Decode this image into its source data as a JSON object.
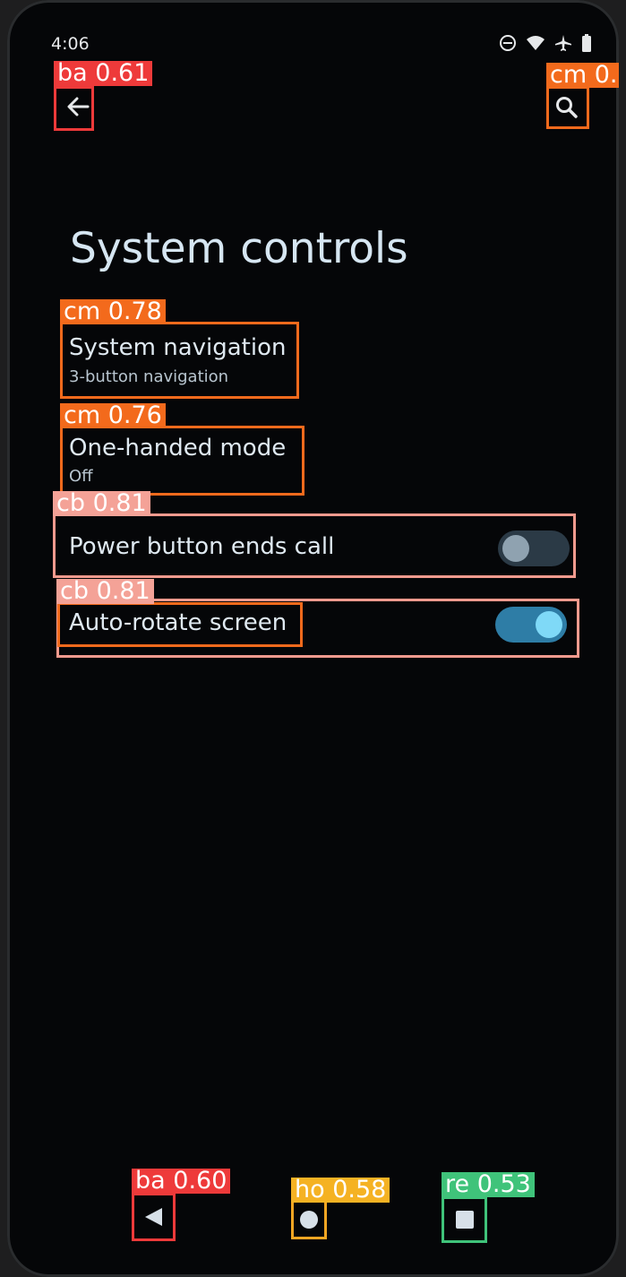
{
  "status_bar": {
    "time": "4:06",
    "icons": [
      "do-not-disturb-icon",
      "wifi-icon",
      "airplane-icon",
      "battery-icon"
    ]
  },
  "header": {
    "back_icon": "arrow-left-icon",
    "search_icon": "search-icon"
  },
  "page": {
    "title": "System controls"
  },
  "settings": [
    {
      "title": "System navigation",
      "subtitle": "3-button navigation"
    },
    {
      "title": "One-handed mode",
      "subtitle": "Off"
    },
    {
      "title": "Power button ends call",
      "toggle_on": false
    },
    {
      "title": "Auto-rotate screen",
      "toggle_on": true
    }
  ],
  "detections": {
    "back": "ba 0.61",
    "search": "cm 0.",
    "system_navigation": "cm 0.78",
    "one_handed": "cm 0.76",
    "power_button": "cb 0.81",
    "auto_rotate": "cb 0.81",
    "nav_back": "ba 0.60",
    "nav_home": "ho 0.58",
    "nav_recents": "re 0.53"
  },
  "nav_bar": {
    "back_icon": "triangle-back-icon",
    "home_icon": "circle-home-icon",
    "recents_icon": "square-recents-icon"
  },
  "colors": {
    "background": "#050608",
    "title_text": "#d6e6f2",
    "toggle_on": "#2e7da6",
    "toggle_off": "#2b3a46"
  }
}
